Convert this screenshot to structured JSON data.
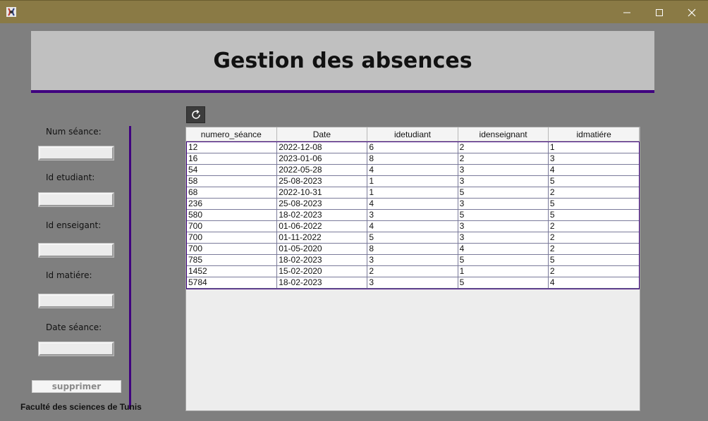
{
  "header": {
    "title": "Gestion des absences"
  },
  "form": {
    "labels": {
      "num_seance": "Num séance:",
      "id_etudiant": "Id etudiant:",
      "id_enseignant": "Id enseigant:",
      "id_matiere": "Id matiére:",
      "date_seance": "Date séance:"
    },
    "values": {
      "num_seance": "",
      "id_etudiant": "",
      "id_enseignant": "",
      "id_matiere": "",
      "date_seance": ""
    },
    "delete_label": "supprimer"
  },
  "footer": {
    "text": "Faculté des sciences de Tunis"
  },
  "table": {
    "columns": [
      "numero_séance",
      "Date",
      "idetudiant",
      "idenseignant",
      "idmatiére"
    ],
    "rows": [
      [
        "12",
        "2022-12-08",
        "6",
        "2",
        "1"
      ],
      [
        "16",
        "2023-01-06",
        "8",
        "2",
        "3"
      ],
      [
        "54",
        "2022-05-28",
        "4",
        "3",
        "4"
      ],
      [
        "58",
        "25-08-2023",
        "1",
        "3",
        "5"
      ],
      [
        "68",
        "2022-10-31",
        "1",
        "5",
        "2"
      ],
      [
        "236",
        "25-08-2023",
        "4",
        "3",
        "5"
      ],
      [
        "580",
        "18-02-2023",
        "3",
        "5",
        "5"
      ],
      [
        "700",
        "01-06-2022",
        "4",
        "3",
        "2"
      ],
      [
        "700",
        "01-11-2022",
        "5",
        "3",
        "2"
      ],
      [
        "700",
        "01-05-2020",
        "8",
        "4",
        "2"
      ],
      [
        "785",
        "18-02-2023",
        "3",
        "5",
        "5"
      ],
      [
        "1452",
        "15-02-2020",
        "2",
        "1",
        "2"
      ],
      [
        "5784",
        "18-02-2023",
        "3",
        "5",
        "4"
      ]
    ]
  },
  "icons": {
    "app": "java-app-icon",
    "minimize": "minimize-icon",
    "maximize": "maximize-icon",
    "close": "close-icon",
    "refresh": "refresh-icon"
  },
  "colors": {
    "titlebar": "#8a7a45",
    "background": "#7f7f7f",
    "header_panel": "#c0c0c0",
    "accent": "#3f007f"
  }
}
